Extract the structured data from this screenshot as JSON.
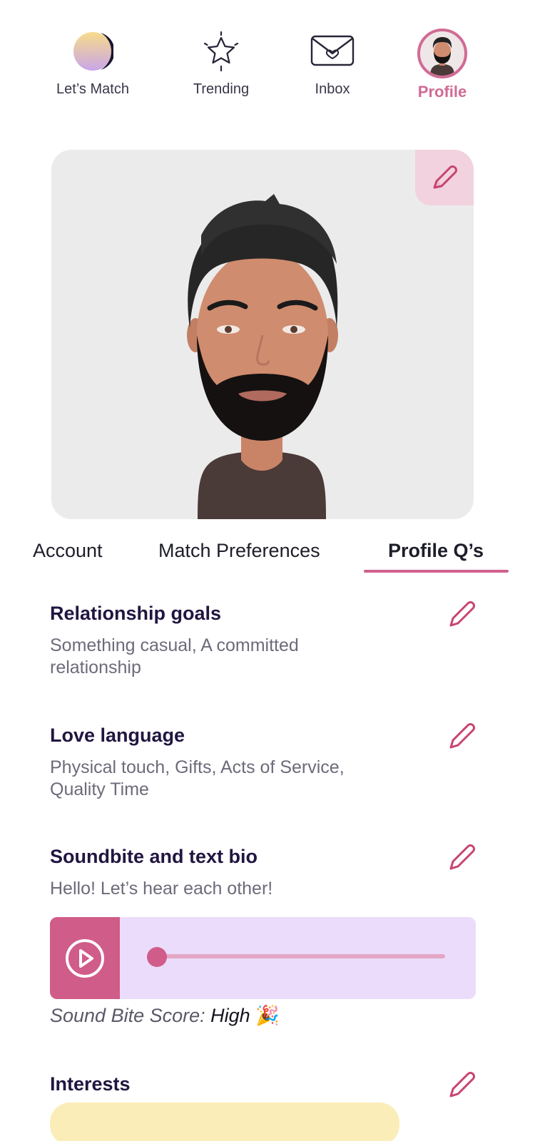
{
  "nav": {
    "items": [
      {
        "label": "Let’s Match",
        "icon": "moon-icon"
      },
      {
        "label": "Trending",
        "icon": "star-icon"
      },
      {
        "label": "Inbox",
        "icon": "envelope-heart-icon"
      },
      {
        "label": "Profile",
        "icon": "avatar"
      }
    ],
    "active": "Profile"
  },
  "tabs": [
    {
      "label": "Account"
    },
    {
      "label": "Match Preferences"
    },
    {
      "label": "Profile Q’s",
      "active": true
    }
  ],
  "sections": {
    "goals": {
      "title": "Relationship goals",
      "text": "Something casual, A committed relationship"
    },
    "love": {
      "title": "Love language",
      "text": "Physical touch, Gifts, Acts of Service, Quality Time"
    },
    "sound": {
      "title": "Soundbite and text bio",
      "text": "Hello! Let’s hear each other!"
    },
    "interests": {
      "title": "Interests"
    }
  },
  "player": {
    "progress": 0.0
  },
  "score": {
    "label": "Sound Bite Score: ",
    "value": "High",
    "emoji": "🎉"
  },
  "colors": {
    "accent": "#d0608d",
    "title": "#211640",
    "player_bg": "#ecdcfb",
    "chip_bg": "#fbedb8"
  }
}
